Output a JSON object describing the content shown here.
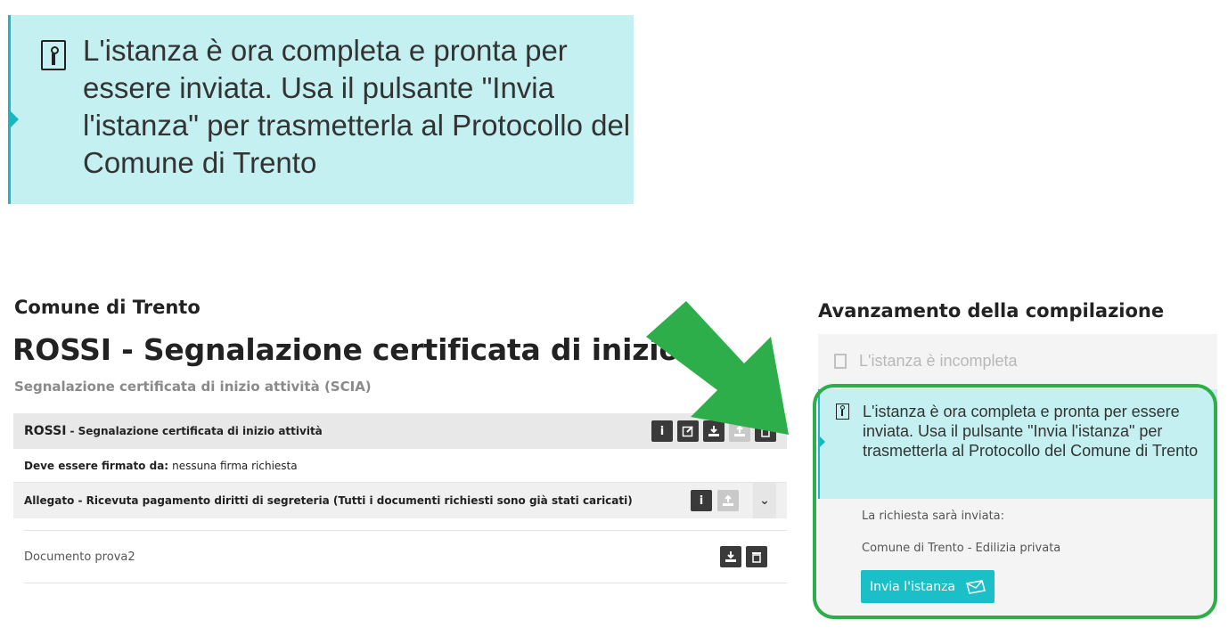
{
  "zoom_callout": {
    "icon": "info-icon",
    "text": "L'istanza è ora completa e pronta per essere inviata. Usa il pulsante \"Invia l'istanza\" per trasmetterla al Protocollo del Comune di Trento"
  },
  "header": {
    "municipality": "Comune di Trento",
    "title": "ROSSI  - Segnalazione certificata di inizio attività",
    "subtitle": "Segnalazione certificata di inizio attività (SCIA)"
  },
  "panel": {
    "main_row": {
      "name": "ROSSI",
      "description": "- Segnalazione certificata di inizio attività",
      "info_btn": "i"
    },
    "sign_row": {
      "label": "Deve essere firmato da:",
      "value": "nessuna firma richiesta"
    },
    "attachment_row": {
      "label": "Allegato - Ricevuta pagamento diritti di segreteria (Tutti i documenti richiesti sono già stati caricati)",
      "info_btn": "i",
      "chevron": "⌄"
    },
    "document_row": {
      "name": "Documento prova2"
    }
  },
  "sidebar": {
    "title": "Avanzamento della compilazione",
    "incomplete_label": "L'istanza è incompleta",
    "complete_text": "L'istanza è ora completa e pronta per essere inviata. Usa il pulsante \"Invia l'istanza\" per trasmetterla al Protocollo del Comune di Trento",
    "send_label": "La richiesta sarà inviata:",
    "destination": "Comune di Trento -",
    "department": "Edilizia privata",
    "send_button": "Invia l'istanza"
  },
  "colors": {
    "callout_bg": "#c4f0f2",
    "accent": "#1bb7c1",
    "highlight": "#2eae4a",
    "send_button": "#1bbfc7"
  }
}
